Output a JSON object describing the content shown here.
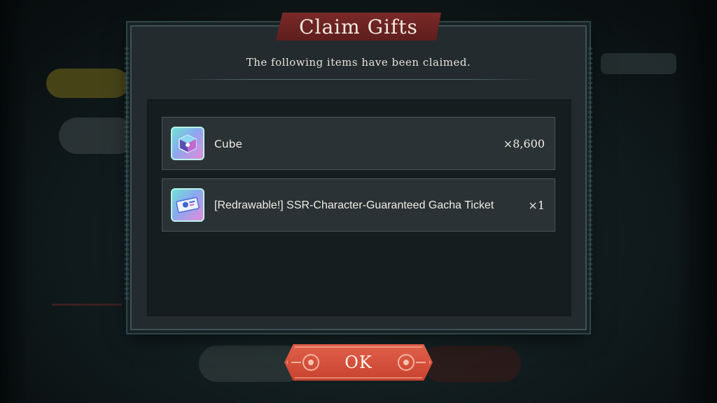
{
  "dialog": {
    "title": "Claim Gifts",
    "subtitle": "The following items have been claimed."
  },
  "items": [
    {
      "name": "Cube",
      "quantity": "×8,600",
      "icon": "cube-icon"
    },
    {
      "name": "[Redrawable!] SSR-Character-Guaranteed Gacha Ticket",
      "quantity": "×1",
      "icon": "gacha-ticket-icon"
    }
  ],
  "ok_button": {
    "label": "OK"
  },
  "colors": {
    "title_banner": "#6e2523",
    "ok_button": "#d3503b",
    "dialog_bg": "#232b2e",
    "item_row_bg": "#2a3235"
  }
}
